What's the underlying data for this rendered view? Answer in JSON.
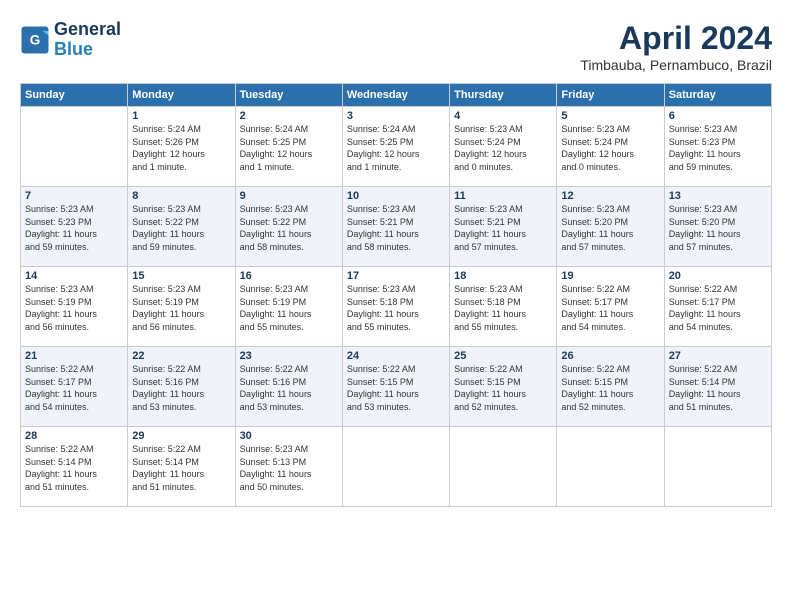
{
  "logo": {
    "line1": "General",
    "line2": "Blue"
  },
  "title": "April 2024",
  "location": "Timbauba, Pernambuco, Brazil",
  "weekdays": [
    "Sunday",
    "Monday",
    "Tuesday",
    "Wednesday",
    "Thursday",
    "Friday",
    "Saturday"
  ],
  "weeks": [
    [
      {
        "num": "",
        "info": ""
      },
      {
        "num": "1",
        "info": "Sunrise: 5:24 AM\nSunset: 5:26 PM\nDaylight: 12 hours\nand 1 minute."
      },
      {
        "num": "2",
        "info": "Sunrise: 5:24 AM\nSunset: 5:25 PM\nDaylight: 12 hours\nand 1 minute."
      },
      {
        "num": "3",
        "info": "Sunrise: 5:24 AM\nSunset: 5:25 PM\nDaylight: 12 hours\nand 1 minute."
      },
      {
        "num": "4",
        "info": "Sunrise: 5:23 AM\nSunset: 5:24 PM\nDaylight: 12 hours\nand 0 minutes."
      },
      {
        "num": "5",
        "info": "Sunrise: 5:23 AM\nSunset: 5:24 PM\nDaylight: 12 hours\nand 0 minutes."
      },
      {
        "num": "6",
        "info": "Sunrise: 5:23 AM\nSunset: 5:23 PM\nDaylight: 11 hours\nand 59 minutes."
      }
    ],
    [
      {
        "num": "7",
        "info": "Sunrise: 5:23 AM\nSunset: 5:23 PM\nDaylight: 11 hours\nand 59 minutes."
      },
      {
        "num": "8",
        "info": "Sunrise: 5:23 AM\nSunset: 5:22 PM\nDaylight: 11 hours\nand 59 minutes."
      },
      {
        "num": "9",
        "info": "Sunrise: 5:23 AM\nSunset: 5:22 PM\nDaylight: 11 hours\nand 58 minutes."
      },
      {
        "num": "10",
        "info": "Sunrise: 5:23 AM\nSunset: 5:21 PM\nDaylight: 11 hours\nand 58 minutes."
      },
      {
        "num": "11",
        "info": "Sunrise: 5:23 AM\nSunset: 5:21 PM\nDaylight: 11 hours\nand 57 minutes."
      },
      {
        "num": "12",
        "info": "Sunrise: 5:23 AM\nSunset: 5:20 PM\nDaylight: 11 hours\nand 57 minutes."
      },
      {
        "num": "13",
        "info": "Sunrise: 5:23 AM\nSunset: 5:20 PM\nDaylight: 11 hours\nand 57 minutes."
      }
    ],
    [
      {
        "num": "14",
        "info": "Sunrise: 5:23 AM\nSunset: 5:19 PM\nDaylight: 11 hours\nand 56 minutes."
      },
      {
        "num": "15",
        "info": "Sunrise: 5:23 AM\nSunset: 5:19 PM\nDaylight: 11 hours\nand 56 minutes."
      },
      {
        "num": "16",
        "info": "Sunrise: 5:23 AM\nSunset: 5:19 PM\nDaylight: 11 hours\nand 55 minutes."
      },
      {
        "num": "17",
        "info": "Sunrise: 5:23 AM\nSunset: 5:18 PM\nDaylight: 11 hours\nand 55 minutes."
      },
      {
        "num": "18",
        "info": "Sunrise: 5:23 AM\nSunset: 5:18 PM\nDaylight: 11 hours\nand 55 minutes."
      },
      {
        "num": "19",
        "info": "Sunrise: 5:22 AM\nSunset: 5:17 PM\nDaylight: 11 hours\nand 54 minutes."
      },
      {
        "num": "20",
        "info": "Sunrise: 5:22 AM\nSunset: 5:17 PM\nDaylight: 11 hours\nand 54 minutes."
      }
    ],
    [
      {
        "num": "21",
        "info": "Sunrise: 5:22 AM\nSunset: 5:17 PM\nDaylight: 11 hours\nand 54 minutes."
      },
      {
        "num": "22",
        "info": "Sunrise: 5:22 AM\nSunset: 5:16 PM\nDaylight: 11 hours\nand 53 minutes."
      },
      {
        "num": "23",
        "info": "Sunrise: 5:22 AM\nSunset: 5:16 PM\nDaylight: 11 hours\nand 53 minutes."
      },
      {
        "num": "24",
        "info": "Sunrise: 5:22 AM\nSunset: 5:15 PM\nDaylight: 11 hours\nand 53 minutes."
      },
      {
        "num": "25",
        "info": "Sunrise: 5:22 AM\nSunset: 5:15 PM\nDaylight: 11 hours\nand 52 minutes."
      },
      {
        "num": "26",
        "info": "Sunrise: 5:22 AM\nSunset: 5:15 PM\nDaylight: 11 hours\nand 52 minutes."
      },
      {
        "num": "27",
        "info": "Sunrise: 5:22 AM\nSunset: 5:14 PM\nDaylight: 11 hours\nand 51 minutes."
      }
    ],
    [
      {
        "num": "28",
        "info": "Sunrise: 5:22 AM\nSunset: 5:14 PM\nDaylight: 11 hours\nand 51 minutes."
      },
      {
        "num": "29",
        "info": "Sunrise: 5:22 AM\nSunset: 5:14 PM\nDaylight: 11 hours\nand 51 minutes."
      },
      {
        "num": "30",
        "info": "Sunrise: 5:23 AM\nSunset: 5:13 PM\nDaylight: 11 hours\nand 50 minutes."
      },
      {
        "num": "",
        "info": ""
      },
      {
        "num": "",
        "info": ""
      },
      {
        "num": "",
        "info": ""
      },
      {
        "num": "",
        "info": ""
      }
    ]
  ]
}
